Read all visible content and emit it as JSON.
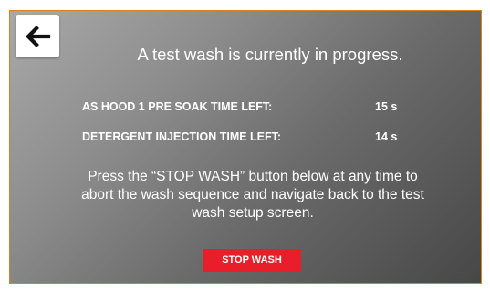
{
  "header": {
    "back_icon": "arrow-left-icon",
    "title": "A test wash is currently in progress."
  },
  "timers": [
    {
      "label": "AS HOOD 1 PRE SOAK TIME LEFT:",
      "value": "15 s"
    },
    {
      "label": "DETERGENT INJECTION TIME LEFT:",
      "value": "14 s"
    }
  ],
  "instructions": "Press the “STOP WASH” button below at any time to abort the wash sequence and navigate back to the test wash setup screen.",
  "stop_button": {
    "label": "STOP WASH"
  },
  "colors": {
    "border": "#d9821e",
    "stop_button": "#e81f2a",
    "text": "#ffffff"
  }
}
